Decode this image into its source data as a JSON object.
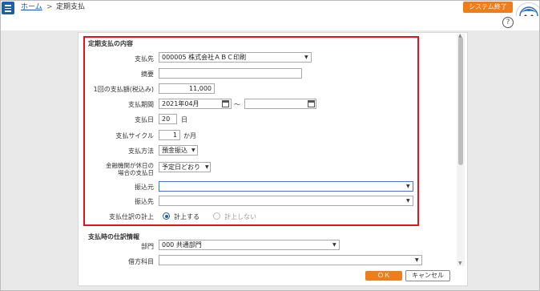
{
  "header": {
    "home": "ホーム",
    "separator": ">",
    "current": "定期支払",
    "exit_button": "システム終了",
    "help": "?"
  },
  "section1": {
    "title": "定期支払の内容",
    "payee_label": "支払先",
    "payee_value": "000005 株式会社ＡＢＣ印刷",
    "memo_label": "摘要",
    "memo_value": "",
    "amount_label": "1回の支払額(税込み)",
    "amount_value": "11,000",
    "period_label": "支払期間",
    "period_start": "2021年04月",
    "period_tilde": "～",
    "period_end": "",
    "day_label": "支払日",
    "day_value": "20",
    "day_unit": "日",
    "cycle_label": "支払サイクル",
    "cycle_value": "1",
    "cycle_unit": "か月",
    "method_label": "支払方法",
    "method_value": "預金振込",
    "holiday_label_1": "金融機関が休日の",
    "holiday_label_2": "場合の支払日",
    "holiday_value": "予定日どおり",
    "from_label": "振込元",
    "from_value": "",
    "to_label": "振込先",
    "to_value": "",
    "journal_label": "支払仕訳の計上",
    "journal_opt_on": "計上する",
    "journal_opt_off": "計上しない"
  },
  "section2": {
    "title": "支払時の仕訳情報",
    "dept_label": "部門",
    "dept_value": "000 共通部門",
    "debit_label": "借方科目",
    "debit_value": ""
  },
  "footer": {
    "ok": "ＯＫ",
    "cancel": "キャンセル"
  },
  "colors": {
    "accent": "#ee7d1b",
    "brand": "#1f5fa8",
    "highlight": "#e3131b"
  }
}
